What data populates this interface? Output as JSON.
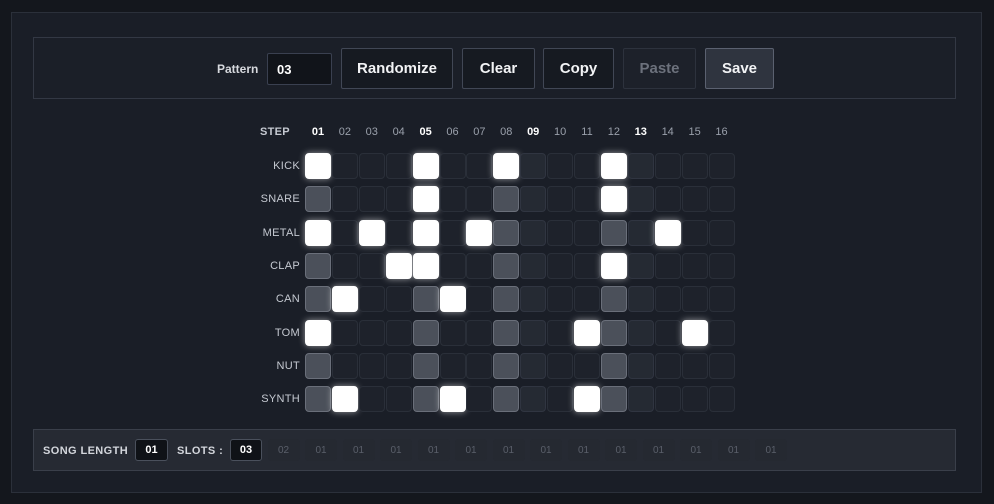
{
  "toolbar": {
    "pattern_label": "Pattern",
    "pattern_value": "03",
    "buttons": {
      "randomize": "Randomize",
      "clear": "Clear",
      "copy": "Copy",
      "paste": "Paste",
      "save": "Save"
    }
  },
  "sequencer": {
    "step_label": "STEP",
    "steps": [
      "01",
      "02",
      "03",
      "04",
      "05",
      "06",
      "07",
      "08",
      "09",
      "10",
      "11",
      "12",
      "13",
      "14",
      "15",
      "16"
    ],
    "accent_steps": [
      1,
      5,
      9,
      13
    ],
    "tracks": [
      {
        "name": "KICK",
        "cells": [
          2,
          0,
          0,
          0,
          2,
          0,
          0,
          2,
          0,
          0,
          0,
          2,
          0,
          0,
          0,
          0
        ]
      },
      {
        "name": "SNARE",
        "cells": [
          1,
          0,
          0,
          0,
          2,
          0,
          0,
          1,
          0,
          0,
          0,
          2,
          0,
          0,
          0,
          0
        ]
      },
      {
        "name": "METAL",
        "cells": [
          2,
          0,
          2,
          0,
          2,
          0,
          2,
          1,
          0,
          0,
          0,
          1,
          0,
          2,
          0,
          0
        ]
      },
      {
        "name": "CLAP",
        "cells": [
          1,
          0,
          0,
          2,
          2,
          0,
          0,
          1,
          0,
          0,
          0,
          2,
          0,
          0,
          0,
          0
        ]
      },
      {
        "name": "CAN",
        "cells": [
          1,
          2,
          0,
          0,
          1,
          2,
          0,
          1,
          0,
          0,
          0,
          1,
          0,
          0,
          0,
          0
        ]
      },
      {
        "name": "TOM",
        "cells": [
          2,
          0,
          0,
          0,
          1,
          0,
          0,
          1,
          0,
          0,
          2,
          1,
          0,
          0,
          2,
          0
        ]
      },
      {
        "name": "NUT",
        "cells": [
          1,
          0,
          0,
          0,
          1,
          0,
          0,
          1,
          0,
          0,
          0,
          1,
          0,
          0,
          0,
          0
        ]
      },
      {
        "name": "SYNTH",
        "cells": [
          1,
          2,
          0,
          0,
          1,
          2,
          0,
          1,
          0,
          0,
          2,
          1,
          0,
          0,
          0,
          0
        ]
      }
    ]
  },
  "song": {
    "length_label": "SONG LENGTH",
    "length_value": "01",
    "slots_label": "SLOTS :",
    "slots": [
      "03",
      "02",
      "01",
      "01",
      "01",
      "01",
      "01",
      "01",
      "01",
      "01",
      "01",
      "01",
      "01",
      "01",
      "01"
    ]
  }
}
